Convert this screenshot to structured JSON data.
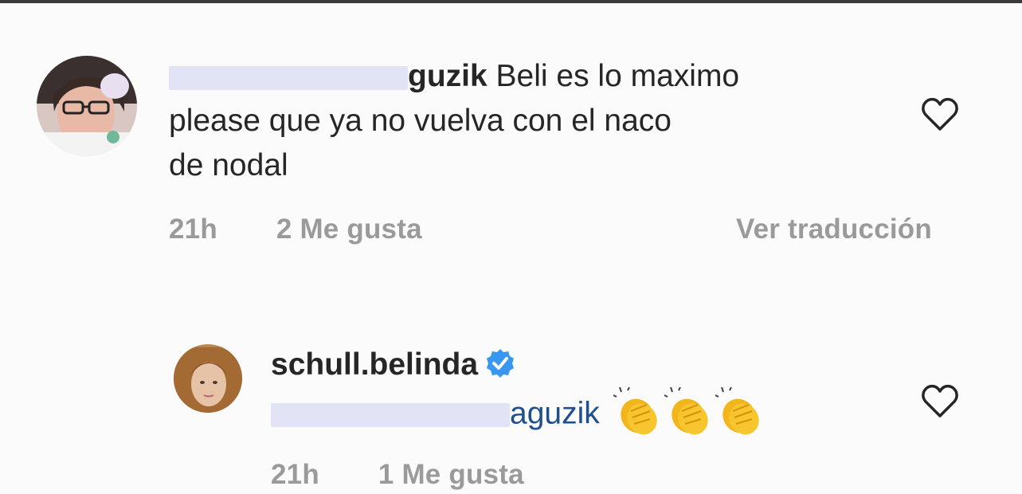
{
  "comment1": {
    "username_visible": "guzik",
    "text_line1": "Beli es lo maximo",
    "text_line2": "please que ya no vuelva con el naco",
    "text_line3": "de nodal",
    "time": "21h",
    "likes": "2 Me gusta",
    "translate": "Ver traducción"
  },
  "comment2": {
    "username": "schull.belinda",
    "mention_visible": "aguzik",
    "time": "21h",
    "likes": "1 Me gusta"
  },
  "icons": {
    "heart": "heart-icon",
    "verified": "verified-badge-icon",
    "clap": "clapping-hands-emoji"
  },
  "colors": {
    "background": "#fbfbfb",
    "text": "#262626",
    "meta": "#9a9a9a",
    "mention": "#1f4f8f",
    "verified": "#3897f0",
    "blur": "#e3e3f6"
  }
}
